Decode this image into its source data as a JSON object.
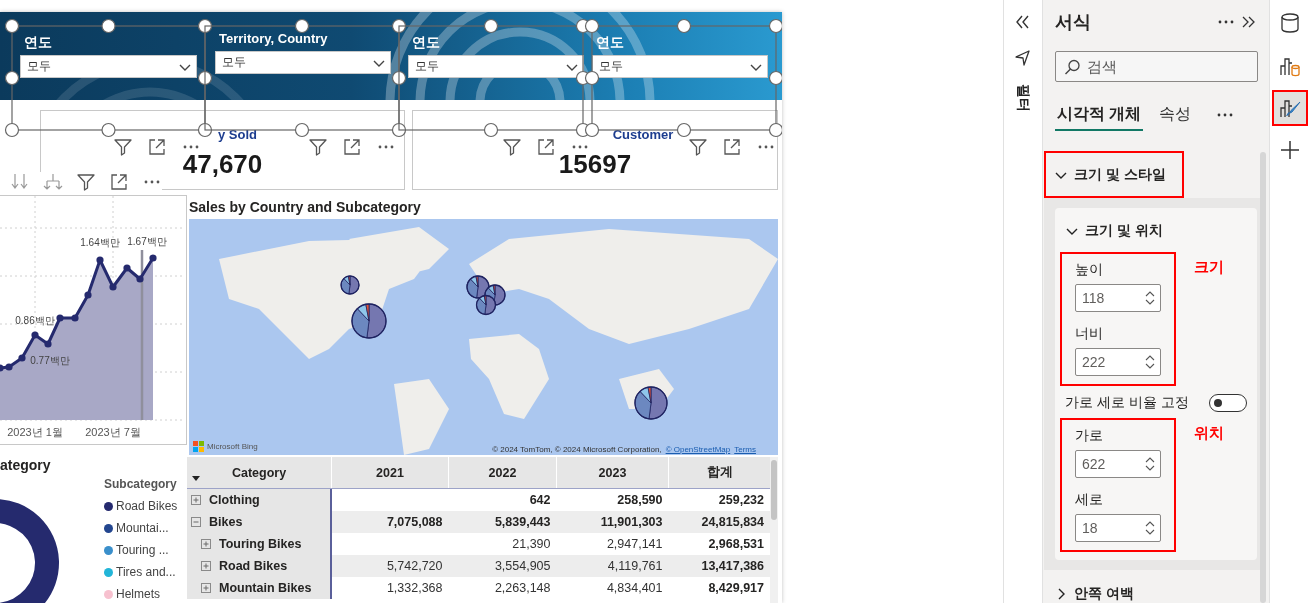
{
  "slicers": [
    {
      "label": "연도",
      "value": "모두"
    },
    {
      "label": "Territory, Country",
      "value": "모두"
    },
    {
      "label": "연도",
      "value": "모두"
    },
    {
      "label": "연도",
      "value": "모두"
    }
  ],
  "cards": [
    {
      "title": "y Sold",
      "value": "47,670"
    },
    {
      "title": "Customer",
      "value": "15697"
    }
  ],
  "line_chart": {
    "data_labels": [
      "1.64백만",
      "1.67백만",
      "0.86백만",
      "0.77백만"
    ],
    "x_labels": [
      "2023년 1월",
      "2023년 7월"
    ]
  },
  "donut": {
    "title": "ategory",
    "legend_title": "Subcategory",
    "legend": [
      {
        "label": "Road Bikes",
        "color": "#252a6e"
      },
      {
        "label": "Mountai...",
        "color": "#23468f"
      },
      {
        "label": "Touring ...",
        "color": "#3a8fcb"
      },
      {
        "label": "Tires and...",
        "color": "#22b5d8"
      },
      {
        "label": "Helmets",
        "color": "#f7c1cf"
      }
    ]
  },
  "map": {
    "title": "Sales by Country and Subcategory",
    "brand": "Microsoft Bing",
    "attribution": "© 2024 TomTom, © 2024 Microsoft Corporation,",
    "links": [
      "© OpenStreetMap",
      "Terms"
    ]
  },
  "matrix": {
    "columns": [
      "Category",
      "2021",
      "2022",
      "2023",
      "합계"
    ],
    "rows": [
      {
        "category": "Clothing",
        "expanded": false,
        "values": [
          "642",
          "258,590",
          "259,232"
        ]
      },
      {
        "category": "Bikes",
        "expanded": true,
        "values": [
          "7,075,088",
          "5,839,443",
          "11,901,303",
          "24,815,834"
        ],
        "children": [
          {
            "category": "Touring Bikes",
            "expanded": false,
            "values": [
              "21,390",
              "2,947,141",
              "2,968,531"
            ]
          },
          {
            "category": "Road Bikes",
            "expanded": false,
            "values": [
              "5,742,720",
              "3,554,905",
              "4,119,761",
              "13,417,386"
            ]
          },
          {
            "category": "Mountain Bikes",
            "expanded": false,
            "values": [
              "1,332,368",
              "2,263,148",
              "4,834,401",
              "8,429,917"
            ]
          }
        ]
      }
    ]
  },
  "filter_pane": {
    "label": "필터"
  },
  "format_pane": {
    "title": "서식",
    "search": {
      "placeholder": "검색"
    },
    "tabs": [
      {
        "label": "시각적 개체",
        "selected": true
      },
      {
        "label": "속성",
        "selected": false
      }
    ],
    "sections": [
      {
        "label": "크기 및 스타일",
        "expanded": true,
        "highlighted": true,
        "groups": [
          {
            "label": "크기 및 위치",
            "expanded": true,
            "blocks": [
              {
                "kind": "group",
                "highlighted": true,
                "note": "크기",
                "fields": [
                  {
                    "label": "높이",
                    "value": "118"
                  },
                  {
                    "label": "너비",
                    "value": "222"
                  }
                ]
              },
              {
                "kind": "toggle",
                "label": "가로 세로 비율 고정",
                "on": false
              },
              {
                "kind": "group",
                "highlighted": true,
                "note": "위치",
                "fields": [
                  {
                    "label": "가로",
                    "value": "622"
                  },
                  {
                    "label": "세로",
                    "value": "18"
                  }
                ]
              }
            ]
          }
        ]
      },
      {
        "label": "안쪽 여백",
        "expanded": false,
        "highlighted": false
      }
    ]
  },
  "rail": [
    {
      "kind": "data",
      "selected": false,
      "highlighted": false
    },
    {
      "kind": "build",
      "selected": false,
      "highlighted": false
    },
    {
      "kind": "format",
      "selected": true,
      "highlighted": true
    },
    {
      "kind": "add",
      "selected": false,
      "highlighted": false
    }
  ]
}
